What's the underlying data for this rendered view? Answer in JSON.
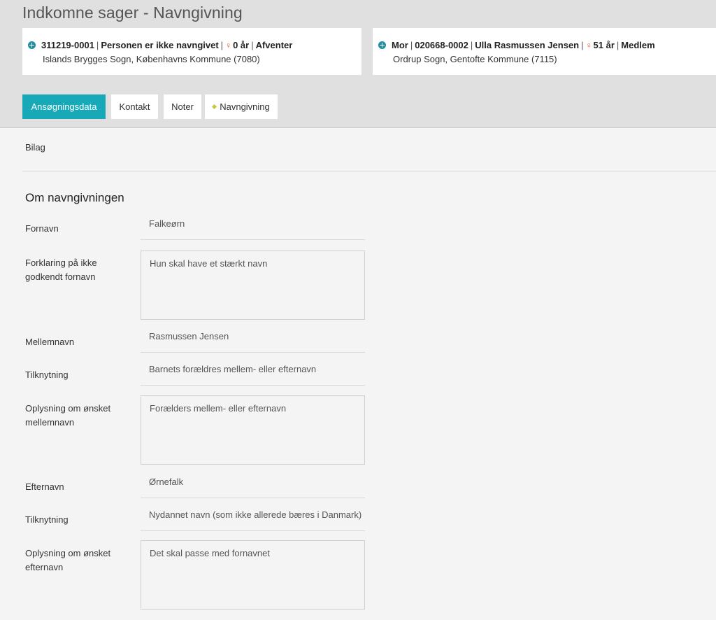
{
  "page": {
    "title": "Indkomne sager - Navngivning"
  },
  "child_card": {
    "id_prefix": "311219-",
    "id_suffix": "0001",
    "status_text": "Personen er ikke navngivet",
    "age": "0 år",
    "membership": "Afventer",
    "location": "Islands Brygges Sogn, Københavns Kommune (7080)"
  },
  "mother_card": {
    "role": "Mor",
    "id_prefix": "020668-",
    "id_suffix": "0002",
    "name": "Ulla Rasmussen Jensen",
    "age": "51 år",
    "membership": "Medlem",
    "location": "Ordrup Sogn, Gentofte Kommune (7115)"
  },
  "separator": "|",
  "tabs": [
    {
      "label": "Ansøgningsdata",
      "active": true
    },
    {
      "label": "Kontakt"
    },
    {
      "label": "Noter"
    },
    {
      "label": "Navngivning"
    }
  ],
  "bilag_label": "Bilag",
  "section_title": "Om navngivningen",
  "fields": {
    "fornavn": {
      "label": "Fornavn",
      "value": "Falkeørn"
    },
    "forklaring": {
      "label": "Forklaring på ikke godkendt fornavn",
      "value": "Hun skal have et stærkt navn"
    },
    "mellemnavn": {
      "label": "Mellemnavn",
      "value": "Rasmussen Jensen"
    },
    "tilknytning1": {
      "label": "Tilknytning",
      "value": "Barnets forældres mellem- eller efternavn"
    },
    "oplysning_mellemnavn": {
      "label": "Oplysning om ønsket mellemnavn",
      "value": "Forælders mellem- eller efternavn"
    },
    "efternavn": {
      "label": "Efternavn",
      "value": "Ørnefalk"
    },
    "tilknytning2": {
      "label": "Tilknytning",
      "value": "Nydannet navn (som ikke allerede bæres i Danmark)"
    },
    "oplysning_efternavn": {
      "label": "Oplysning om ønsket efternavn",
      "value": "Det skal passe med fornavnet"
    }
  },
  "colors": {
    "accent": "#17a9b8",
    "person_icon": "#d9531e",
    "header_bg": "#e0e0e0"
  }
}
